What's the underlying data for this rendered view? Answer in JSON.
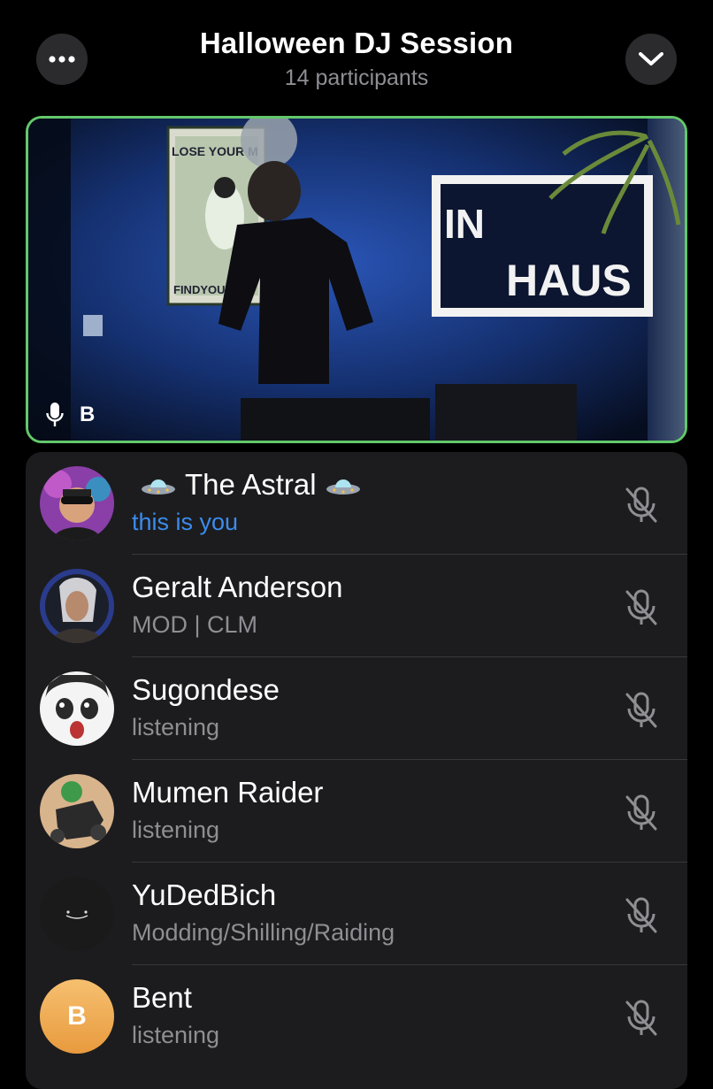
{
  "header": {
    "title": "Halloween DJ Session",
    "subtitle": "14 participants",
    "more_icon": "ellipsis-icon",
    "collapse_icon": "chevron-down-icon"
  },
  "video": {
    "speaker_initial": "B",
    "mic_icon": "microphone-icon",
    "active_border_color": "#63c86b",
    "scene_text": {
      "poster_top": "LOSE YOUR M",
      "poster_bottom": "FINDYOURSO",
      "sign_line1": "IN",
      "sign_line2": "HAUS"
    }
  },
  "participants": [
    {
      "name": "The Astral",
      "status": "this is you",
      "is_you": true,
      "name_icon": "ufo-icon",
      "mic_icon": "mic-off-icon"
    },
    {
      "name": "Geralt Anderson",
      "status": "MOD | CLM",
      "is_you": false,
      "mic_icon": "mic-off-icon"
    },
    {
      "name": "Sugondese",
      "status": "listening",
      "is_you": false,
      "mic_icon": "mic-off-icon"
    },
    {
      "name": "Mumen Raider",
      "status": "listening",
      "is_you": false,
      "mic_icon": "mic-off-icon"
    },
    {
      "name": "YuDedBich",
      "status": "Modding/Shilling/Raiding",
      "is_you": false,
      "mic_icon": "mic-off-icon"
    },
    {
      "name": "Bent",
      "status": "listening",
      "is_you": false,
      "avatar_initial": "B",
      "mic_icon": "mic-off-icon"
    }
  ],
  "colors": {
    "you_status": "#3b8ced",
    "secondary_text": "#8e8e93",
    "list_bg": "#1c1c1e",
    "avatar_orange": "#f0a94f"
  }
}
